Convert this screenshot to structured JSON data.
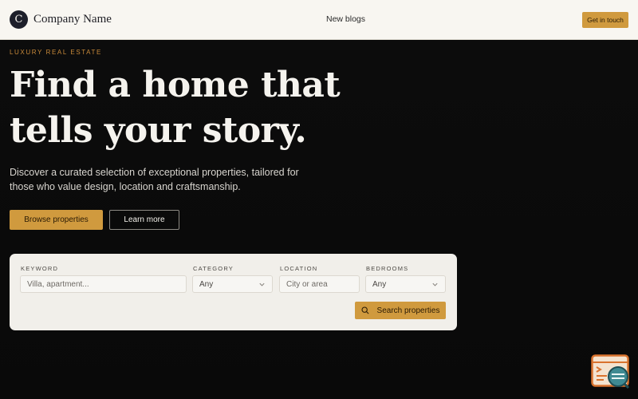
{
  "header": {
    "logo_letter": "C",
    "company_name": "Company Name",
    "nav_link": "New blogs",
    "cta_label": "Get in touch"
  },
  "hero": {
    "eyebrow": "LUXURY REAL ESTATE",
    "headline_line1": "Find a home that",
    "headline_line2": "tells your story.",
    "subtitle": "Discover a curated selection of exceptional properties, tailored for those who value design, location and craftsmanship.",
    "primary_button": "Browse properties",
    "secondary_button": "Learn more"
  },
  "search": {
    "keyword": {
      "label": "KEYWORD",
      "placeholder": "Villa, apartment...",
      "value": ""
    },
    "category": {
      "label": "CATEGORY",
      "selected": "Any"
    },
    "location": {
      "label": "LOCATION",
      "placeholder": "City or area",
      "value": ""
    },
    "bedrooms": {
      "label": "BEDROOMS",
      "selected": "Any"
    },
    "submit_label": "Search properties"
  },
  "colors": {
    "accent": "#d09a3e",
    "eyebrow": "#c98a3a",
    "header_bg": "#f8f6f1",
    "hero_bg": "#0b0b0b",
    "card_bg": "#f1efea"
  },
  "icons": {
    "select_arrow": "chevron-down-icon",
    "search": "search-icon",
    "widget": "chat-widget-icon"
  }
}
